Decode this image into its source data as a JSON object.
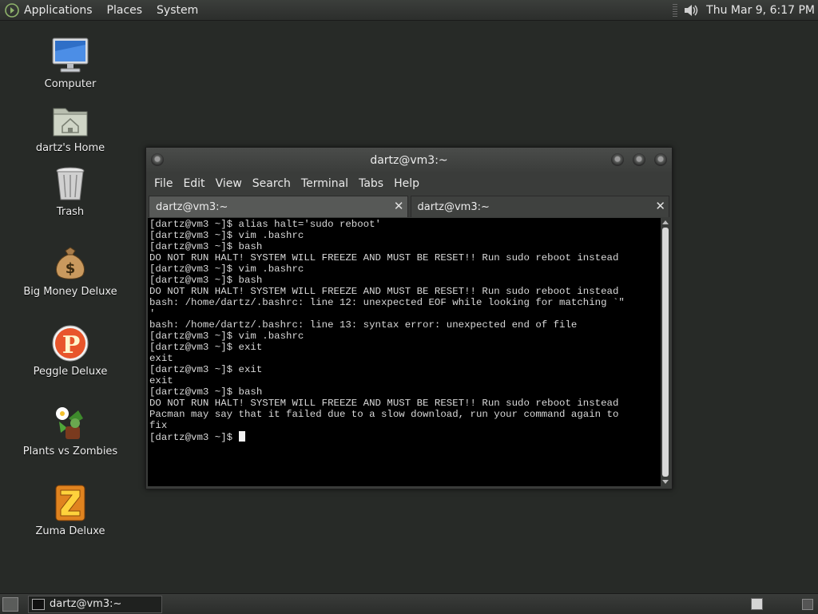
{
  "top_panel": {
    "menus": [
      "Applications",
      "Places",
      "System"
    ],
    "clock": "Thu Mar  9,  6:17 PM"
  },
  "desktop": {
    "icons": [
      {
        "label": "Computer",
        "icon": "computer-icon"
      },
      {
        "label": "dartz's Home",
        "icon": "home-folder-icon"
      },
      {
        "label": "Trash",
        "icon": "trash-icon"
      },
      {
        "label": "Big Money Deluxe",
        "icon": "money-bag-icon"
      },
      {
        "label": "Peggle Deluxe",
        "icon": "peggle-icon"
      },
      {
        "label": "Plants vs Zombies",
        "icon": "plants-vs-zombies-icon"
      },
      {
        "label": "Zuma Deluxe",
        "icon": "zuma-icon"
      }
    ]
  },
  "terminal": {
    "title": "dartz@vm3:~",
    "menu": [
      "File",
      "Edit",
      "View",
      "Search",
      "Terminal",
      "Tabs",
      "Help"
    ],
    "tabs": [
      {
        "label": "dartz@vm3:~",
        "close": "✕"
      },
      {
        "label": "dartz@vm3:~",
        "close": "✕"
      }
    ],
    "lines": [
      "[dartz@vm3 ~]$ alias halt='sudo reboot'",
      "[dartz@vm3 ~]$ vim .bashrc",
      "[dartz@vm3 ~]$ bash",
      "DO NOT RUN HALT! SYSTEM WILL FREEZE AND MUST BE RESET!! Run sudo reboot instead",
      "[dartz@vm3 ~]$ vim .bashrc",
      "[dartz@vm3 ~]$ bash",
      "DO NOT RUN HALT! SYSTEM WILL FREEZE AND MUST BE RESET!! Run sudo reboot instead",
      "bash: /home/dartz/.bashrc: line 12: unexpected EOF while looking for matching `\"",
      "'",
      "bash: /home/dartz/.bashrc: line 13: syntax error: unexpected end of file",
      "[dartz@vm3 ~]$ vim .bashrc",
      "[dartz@vm3 ~]$ exit",
      "exit",
      "[dartz@vm3 ~]$ exit",
      "exit",
      "[dartz@vm3 ~]$ bash",
      "DO NOT RUN HALT! SYSTEM WILL FREEZE AND MUST BE RESET!! Run sudo reboot instead",
      "Pacman may say that it failed due to a slow download, run your command again to",
      "fix"
    ],
    "prompt": "[dartz@vm3 ~]$ "
  },
  "bottom_panel": {
    "task_label": "dartz@vm3:~"
  }
}
